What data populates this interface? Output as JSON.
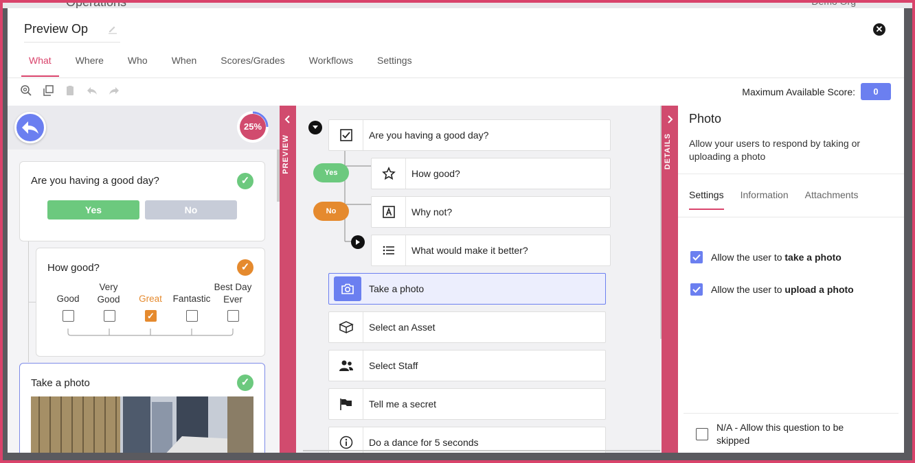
{
  "background": {
    "page_title": "Operations",
    "org": "Demo Org"
  },
  "header": {
    "title": "Preview Op",
    "close_icon": "close-icon",
    "edit_icon": "pencil-icon"
  },
  "tabs": [
    {
      "label": "What",
      "active": true
    },
    {
      "label": "Where"
    },
    {
      "label": "Who"
    },
    {
      "label": "When"
    },
    {
      "label": "Scores/Grades"
    },
    {
      "label": "Workflows"
    },
    {
      "label": "Settings"
    }
  ],
  "toolbar": {
    "icons": [
      "zoom-icon",
      "copy-icon",
      "paste-icon",
      "undo-icon",
      "redo-icon"
    ],
    "max_score_label": "Maximum Available Score:",
    "max_score_value": "0"
  },
  "preview": {
    "progress_label": "25%",
    "progress_value": 0.25,
    "q1": {
      "title": "Are you having a good day?",
      "yes": "Yes",
      "no": "No"
    },
    "q2": {
      "title": "How good?",
      "options": [
        {
          "label": "Good",
          "selected": false
        },
        {
          "label": "Very Good",
          "selected": false
        },
        {
          "label": "Great",
          "selected": true
        },
        {
          "label": "Fantastic",
          "selected": false
        },
        {
          "label": "Best Day Ever",
          "selected": false
        }
      ]
    },
    "q3": {
      "title": "Take a photo"
    },
    "rail_label": "PREVIEW"
  },
  "flow": {
    "nodes": [
      {
        "label": "Are you having a good day?",
        "icon": "checkbox-icon"
      },
      {
        "label": "How good?",
        "icon": "star-icon"
      },
      {
        "label": "Why not?",
        "icon": "text-icon"
      },
      {
        "label": "What would make it better?",
        "icon": "list-icon"
      },
      {
        "label": "Take a photo",
        "icon": "camera-icon",
        "selected": true
      },
      {
        "label": "Select an Asset",
        "icon": "box-icon"
      },
      {
        "label": "Select Staff",
        "icon": "people-icon"
      },
      {
        "label": "Tell me a secret",
        "icon": "flag-icon"
      },
      {
        "label": "Do a dance for 5 seconds",
        "icon": "info-icon"
      }
    ],
    "yes_pill": "Yes",
    "no_pill": "No"
  },
  "details": {
    "rail_label": "DETAILS",
    "title": "Photo",
    "description": "Allow your users to respond by taking or uploading a photo",
    "tabs": [
      "Settings",
      "Information",
      "Attachments"
    ],
    "opt_take_prefix": "Allow the user to ",
    "opt_take_bold": "take a photo",
    "opt_upload_prefix": "Allow the user to ",
    "opt_upload_bold": "upload a photo",
    "na_label": "N/A - Allow this question to be skipped"
  },
  "colors": {
    "accent": "#d9436b",
    "primary": "#6b7ff0",
    "yes": "#6cc97e",
    "no": "#e58a2e"
  }
}
